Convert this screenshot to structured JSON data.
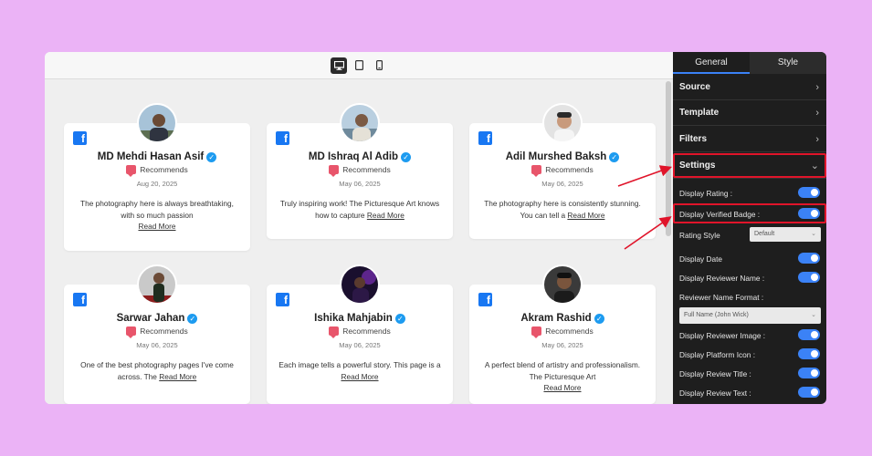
{
  "toolbar": {
    "devices": [
      {
        "name": "desktop-icon",
        "active": true
      },
      {
        "name": "tablet-icon",
        "active": false
      },
      {
        "name": "mobile-icon",
        "active": false
      }
    ]
  },
  "reviews": [
    {
      "name": "MD Mehdi Hasan Asif",
      "recommends": "Recommends",
      "date": "Aug 20, 2025",
      "text": "The photography here is always breathtaking, with so much passion",
      "read_more": "Read More",
      "platform": "facebook-icon"
    },
    {
      "name": "MD Ishraq Al Adib",
      "recommends": "Recommends",
      "date": "May 06, 2025",
      "text": "Truly inspiring work! The Picturesque Art knows how to capture",
      "read_more": "Read More",
      "platform": "facebook-icon"
    },
    {
      "name": "Adil Murshed Baksh",
      "recommends": "Recommends",
      "date": "May 06, 2025",
      "text": "The photography here is consistently stunning. You can tell a",
      "read_more": "Read More",
      "platform": "facebook-icon"
    },
    {
      "name": "Sarwar Jahan",
      "recommends": "Recommends",
      "date": "May 06, 2025",
      "text": "One of the best photography pages I've come across. The",
      "read_more": "Read More",
      "platform": "facebook-icon"
    },
    {
      "name": "Ishika Mahjabin",
      "recommends": "Recommends",
      "date": "May 06, 2025",
      "text": "Each image tells a powerful story. This page is a",
      "read_more": "Read More",
      "platform": "facebook-icon"
    },
    {
      "name": "Akram Rashid",
      "recommends": "Recommends",
      "date": "May 06, 2025",
      "text": "A perfect blend of artistry and professionalism. The Picturesque Art",
      "read_more": "Read More",
      "platform": "facebook-icon"
    }
  ],
  "sidebar": {
    "tabs": [
      {
        "label": "General",
        "active": true
      },
      {
        "label": "Style",
        "active": false
      }
    ],
    "sections": {
      "source": "Source",
      "template": "Template",
      "filters": "Filters",
      "settings": "Settings"
    },
    "options": {
      "display_rating": {
        "label": "Display Rating :",
        "on": true
      },
      "display_verified_badge": {
        "label": "Display Verified Badge :",
        "on": true
      },
      "rating_style": {
        "label": "Rating Style",
        "value": "Default"
      },
      "display_date": {
        "label": "Display Date",
        "on": true
      },
      "display_reviewer_name": {
        "label": "Display Reviewer Name :",
        "on": true
      },
      "reviewer_name_format": {
        "label": "Reviewer Name Format :",
        "value": "Full Name (John Wick)"
      },
      "display_reviewer_image": {
        "label": "Display Reviewer Image :",
        "on": true
      },
      "display_platform_icon": {
        "label": "Display Platform Icon :",
        "on": true
      },
      "display_review_title": {
        "label": "Display Review Title :",
        "on": true
      },
      "display_review_text": {
        "label": "Display Review Text :",
        "on": true
      }
    }
  },
  "colors": {
    "background": "#ebb3f6",
    "accent": "#3b82f6",
    "highlight": "#e0142a",
    "facebook": "#1877f2",
    "verified": "#1d9bf0"
  }
}
